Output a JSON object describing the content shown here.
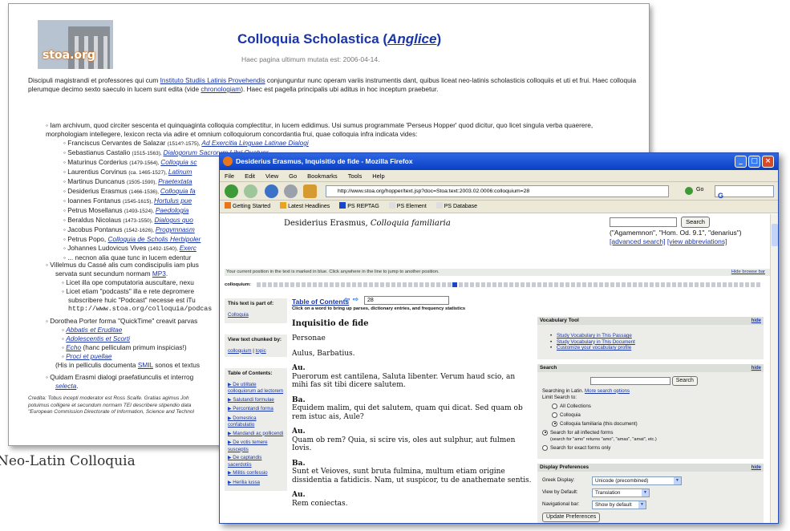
{
  "background_page": {
    "logo_text": "stoa.org",
    "title_main": "Colloquia Scholastica (",
    "title_link": "Anglice",
    "title_end": ")",
    "updated": "Haec pagina ultimum mutata est: 2006-04-14.",
    "intro_a": "Discipuli magistrandi et professores qui cum ",
    "intro_link1": "Instituto Studiis Latinis Provehendis",
    "intro_b": " conjunguntur nunc operam variis instrumentis dant, quibus liceat neo-latinis scholasticis colloquiis et uti et frui. Haec colloquia plerumque decimo sexto saeculo in lucem sunt edita (vide ",
    "intro_link2": "chronologiam",
    "intro_c": "). Haec est pagella principalis ubi aditus in hoc inceptum praebetur.",
    "archive_text": "Iam archivum, quod circiter sescenta et quinquaginta colloquia complectitur, in lucem edidimus. Usi sumus programmate 'Perseus Hopper' quod dicitur, quo licet singula verba quaerere, morphologiam intellegere, lexicon recta via adire et omnium colloquiorum concordantia frui, quae colloquia infra indicata vides:",
    "authors": [
      {
        "name": "Franciscus Cervantes de Salazar",
        "dates": "(1514?-1575),",
        "work": "Ad Exercitia Linguae Latinae Dialogi"
      },
      {
        "name": "Sebastianus Castalio",
        "dates": "(1515-1563),",
        "work": "Dialogorum Sacrorum Libri Quatuor"
      },
      {
        "name": "Maturinus Corderius",
        "dates": "(1479-1564),",
        "work": "Colloquia sc"
      },
      {
        "name": "Laurentius Corvinus",
        "dates": "(ca. 1465-1527),",
        "work": "Latinum"
      },
      {
        "name": "Martinus Duncanus",
        "dates": "(1505-1590),",
        "work": "Praetextata"
      },
      {
        "name": "Desiderius Erasmus",
        "dates": "(1466-1536),",
        "work": "Colloquia fa"
      },
      {
        "name": "Ioannes Fontanus",
        "dates": "(1545-1615),",
        "work": "Hortulus pue"
      },
      {
        "name": "Petrus Mosellanus",
        "dates": "(1493-1524),",
        "work": "Paedologia"
      },
      {
        "name": "Beraldus Nicolaus",
        "dates": "(1473-1550),",
        "work": "Dialogus quo"
      },
      {
        "name": "Jacobus Pontanus",
        "dates": "(1542-1626),",
        "work": "Progymnasm"
      },
      {
        "name": "Petrus Popo,",
        "dates": "",
        "work": "Colloquia de Scholis Herbipoler"
      },
      {
        "name": "Johannes Ludovicus Vives",
        "dates": "(1492-1540),",
        "work": "Exerc"
      },
      {
        "name": "... necnon alia quae tunc in lucem edentur",
        "dates": "",
        "work": ""
      }
    ],
    "villelmus": "Villelmus du Cassé alis cum condiscipulis iam plus",
    "villelmus_2": "servata sunt secundum normam",
    "villelmus_link": "MP3",
    "licet_1": "Licet illa ope computatoria auscultare, nexu",
    "licet_2": "Licet etiam \"podcasts\" illa e rete depromere",
    "licet_3": "subscribere huic \"Podcast\" necesse est iTu",
    "podcast_url": "http://www.stoa.org/colloquia/podcas",
    "dorothea": "Dorothea Porter forma \"QuickTime\" creavit parvas",
    "films": [
      "Abbatis et Eruditae",
      "Adolescentis et Scorti"
    ],
    "echo_link": "Echo",
    "echo_note": " (hanc pelliculam primum inspicias!)",
    "proci": "Proci et puellae",
    "smil_a": "(His in pelliculis documenta ",
    "smil_link": "SMIL",
    "smil_b": " sonos et textus",
    "quidam": "Quidam Erasmi dialogi praefatiunculis et interrog",
    "selecta": "selecta",
    "credit_1": "Credita: Tobus incepti moderator est Ross Scaife. Gratias agimus Joh",
    "credit_2": "potuimus colligere et secundum normam TEI describere stipendio data",
    "credit_3": "\"European Commission Directorate of Information, Science and Technol",
    "caption": "Neo-Latin Colloquia"
  },
  "firefox": {
    "window_title": "Desiderius Erasmus, Inquisitio de fide - Mozilla Firefox",
    "menu": [
      "File",
      "Edit",
      "View",
      "Go",
      "Bookmarks",
      "Tools",
      "Help"
    ],
    "url": "http://www.stoa.org/hopper/text.jsp?doc=Stoa:text:2003.02.0006:colloquium=28",
    "go_label": "Go",
    "search_letter": "G",
    "bookmarks": [
      "Getting Started",
      "Latest Headlines",
      "PS REPTAG",
      "PS Element",
      "PS Database"
    ],
    "doc_author": "Desiderius Erasmus, ",
    "doc_title": "Colloquia familiaria",
    "search_button": "Search",
    "search_examples": "(\"Agamemnon\", \"Hom. Od. 9.1\", \"denarius\")",
    "advanced_search": "[advanced search]",
    "view_abbrev": "[view abbreviations]",
    "position_note": "Your current position in the text is marked in blue. Click anywhere in the line to jump to another position.",
    "hide_browse": "Hide browse bar",
    "colloquium_label": "colloquium:",
    "left_panels": {
      "part_of_title": "This text is part of:",
      "part_of_link": "Colloquia",
      "chunked_title": "View text chunked by:",
      "chunk_colloquium": "colloquium",
      "chunk_sep": " | ",
      "chunk_topic": "topic",
      "toc_title": "Table of Contents:",
      "toc_items": [
        "De utilitate colloquiorum ad lectorem",
        "Salutandi formulae",
        "Percontandi forma",
        "Domestica confabulatio",
        "Mandandi ac pollicendi",
        "De votis temere susceptis",
        "De captandis sacerdotiis",
        "Militis confessio",
        "Herilia iussa"
      ]
    },
    "toc_heading": "Table of Contents",
    "toc_note": "Click on a word to bring up parses, dictionary entries, and frequency statistics",
    "page_value": "28",
    "text": {
      "title": "Inquisitio de fide",
      "personae_label": "Personae",
      "personae": "Aulus, Barbatius.",
      "lines": [
        {
          "speaker": "Au.",
          "text": "Puerorum est cantilena, Saluta libenter. Verum haud scio, an mihi fas sit tibi dicere salutem."
        },
        {
          "speaker": "Ba.",
          "text": "Equidem malim, qui det salutem, quam qui dicat. Sed quam ob rem istuc ais, Aule?"
        },
        {
          "speaker": "Au.",
          "text": "Quam ob rem? Quia, si scire vis, oles aut sulphur, aut fulmen Iovis."
        },
        {
          "speaker": "Ba.",
          "text": "Sunt et Veioves, sunt bruta fulmina, multum etiam origine dissidentia a fatidicis. Nam, ut suspicor, tu de anathemate sentis."
        },
        {
          "speaker": "Au.",
          "text": "Rem coniectas."
        }
      ]
    },
    "vocab": {
      "title": "Vocabulary Tool",
      "hide": "hide",
      "links": [
        "Study Vocabulary in This Passage",
        "Study Vocabulary in This Document",
        "Customize your vocabulary profile"
      ]
    },
    "search": {
      "title": "Search",
      "hide": "hide",
      "button": "Search",
      "searching_in": "Searching in Latin. ",
      "more_options": "More search options",
      "limit": "Limit Search to:",
      "options": [
        {
          "label": "All Collections",
          "checked": false
        },
        {
          "label": "Colloquia",
          "checked": false
        },
        {
          "label": "Colloquia familiaria (this document)",
          "checked": true
        }
      ],
      "forms": [
        {
          "label": "Search for all inflected forms",
          "note": "(search for \"amo\" returns \"amo\", \"amas\", \"amat\", etc.)",
          "checked": true
        },
        {
          "label": "Search for exact forms only",
          "note": "",
          "checked": false
        }
      ]
    },
    "display": {
      "title": "Display Preferences",
      "hide": "hide",
      "greek_label": "Greek Display:",
      "greek_value": "Unicode (precombined)",
      "view_label": "View by Default:",
      "view_value": "Translation",
      "nav_label": "Navigational bar:",
      "nav_value": "Show by default",
      "update": "Update Preferences"
    }
  }
}
